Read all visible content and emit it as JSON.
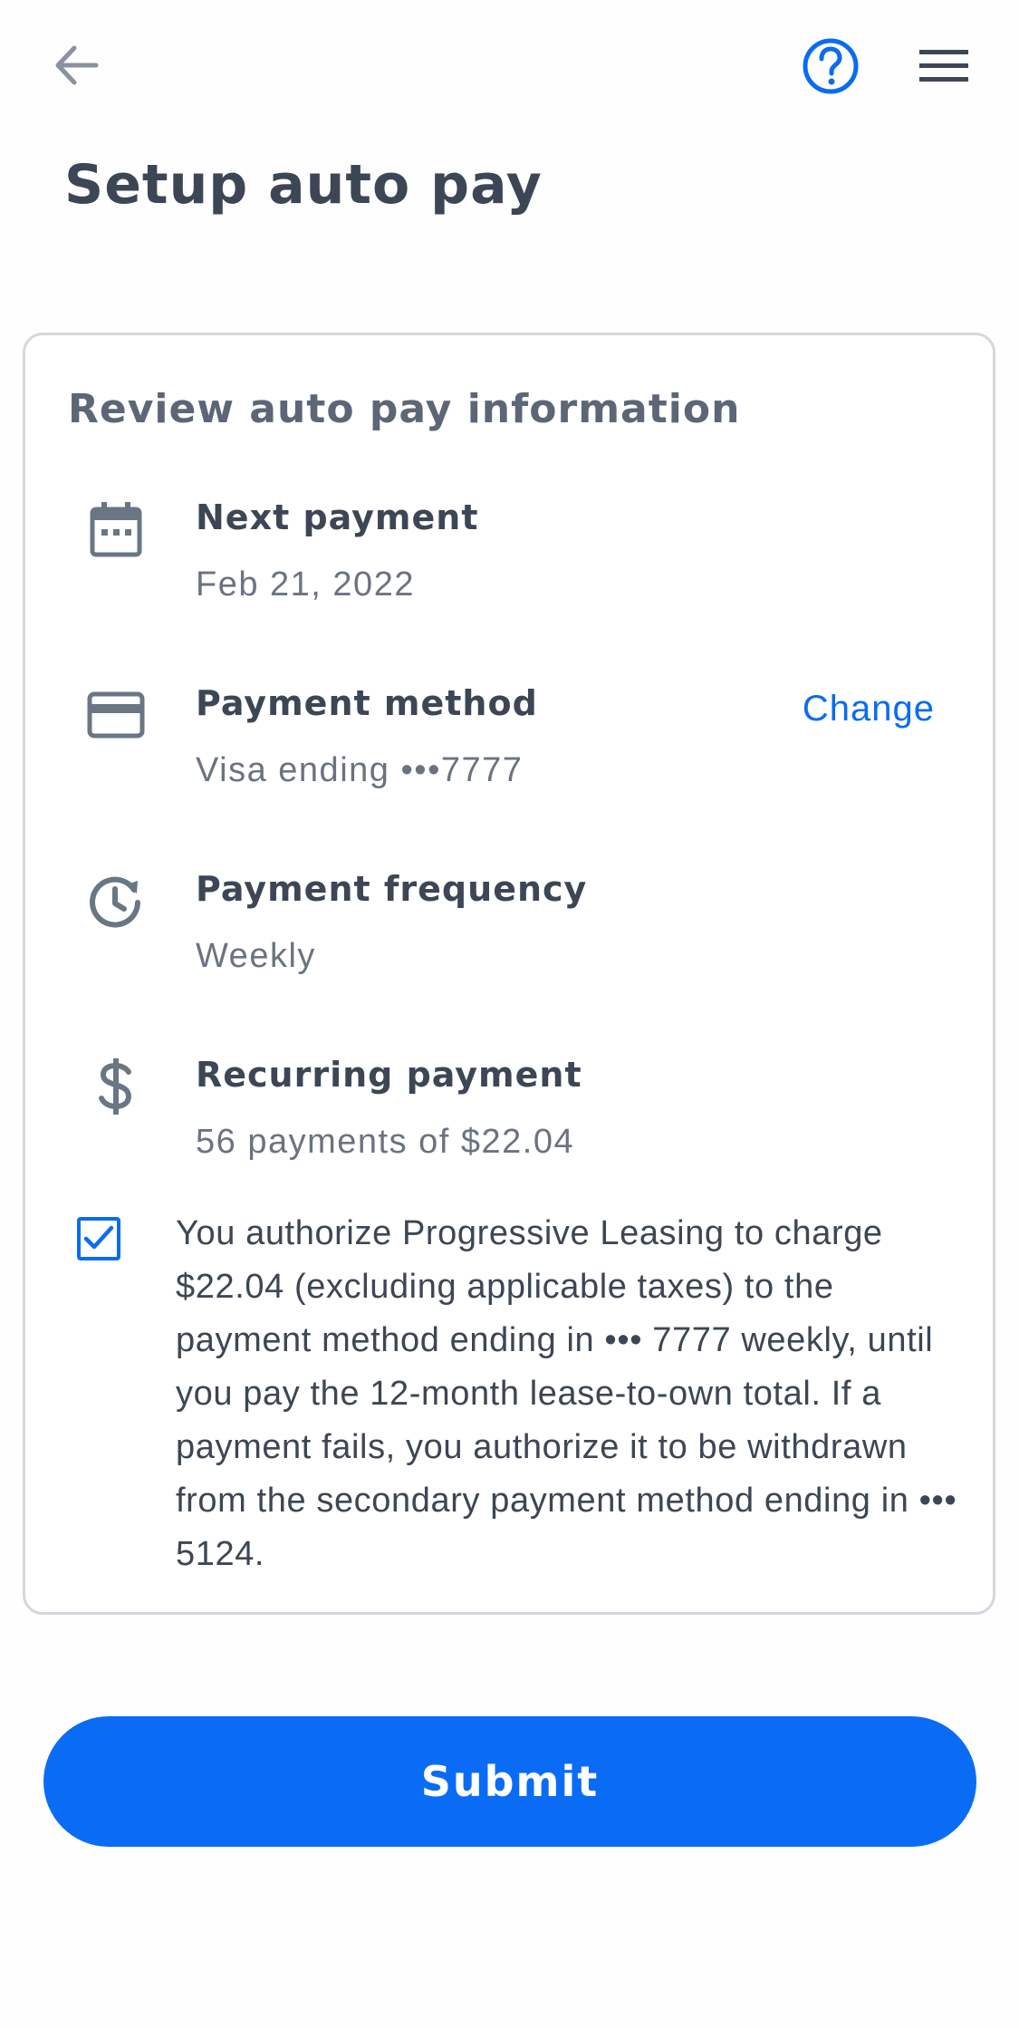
{
  "header": {
    "back_icon": "arrow-left-icon",
    "help_icon": "question-circle-icon",
    "menu_icon": "hamburger-menu-icon",
    "title": "Setup auto pay"
  },
  "card": {
    "title": "Review auto pay information",
    "rows": [
      {
        "icon": "calendar-icon",
        "label": "Next payment",
        "value": "Feb 21, 2022"
      },
      {
        "icon": "credit-card-icon",
        "label": "Payment method",
        "value": "Visa ending •••7777",
        "action": "Change"
      },
      {
        "icon": "clock-history-icon",
        "label": "Payment frequency",
        "value": "Weekly"
      },
      {
        "icon": "dollar-icon",
        "label": "Recurring payment",
        "value": "56 payments of $22.04"
      }
    ],
    "authorization": {
      "checked": true,
      "text": "You authorize Progressive Leasing to charge $22.04 (excluding applicable taxes) to the payment method ending in ••• 7777 weekly, until you pay the 12-month lease-to-own total. If a payment fails, you authorize it to be withdrawn from the secondary payment method ending in ••• 5124."
    }
  },
  "submit_label": "Submit",
  "colors": {
    "accent": "#0a6cf5",
    "text_dark": "#3d4654",
    "text_muted": "#6b7380",
    "icon_gray": "#6b7684",
    "border": "#d4d8de"
  }
}
